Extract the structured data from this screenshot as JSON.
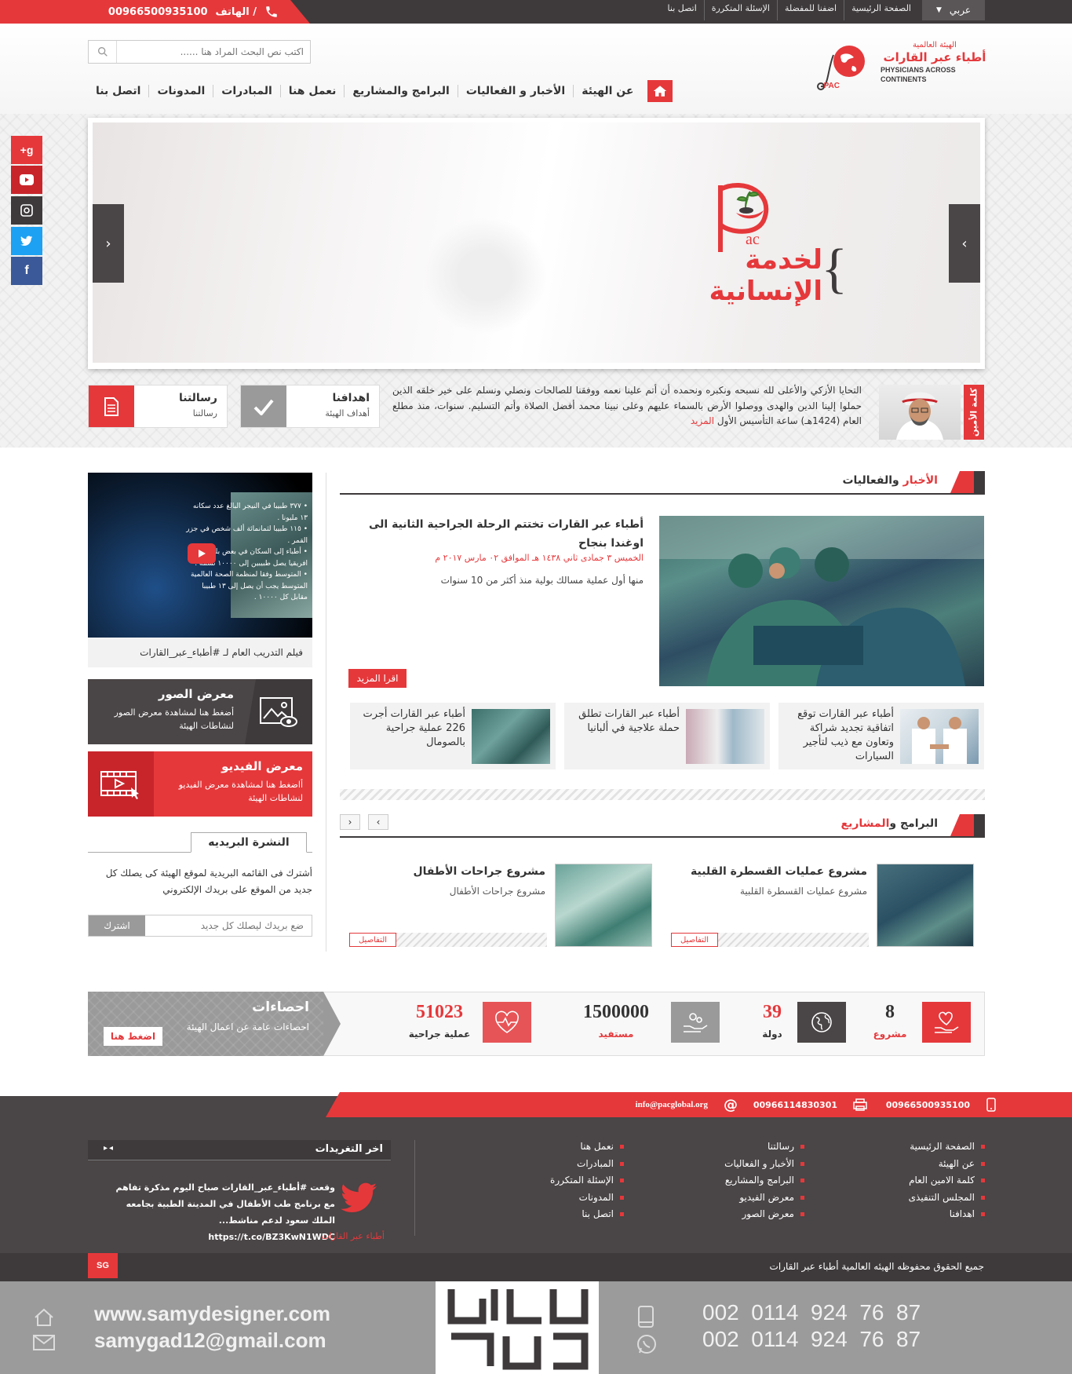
{
  "topbar": {
    "phone_label": "الهاتف /",
    "phone_number": "00966500935100",
    "links": [
      "الصفحة الرئيسية",
      "اضفنا للمفضلة",
      "الإسئلة المتكررة",
      "اتصل بنا"
    ],
    "language": "عربي"
  },
  "logo": {
    "org_small": "الهيئة العالمية",
    "org_name_ar": "أطباء عبر القارات",
    "org_name_en_1": "PHYSICIANS ACROSS",
    "org_name_en_2": "CONTINENTS",
    "abbr": "PAC"
  },
  "search": {
    "placeholder": "اكتب نص البحث المراد هنا ......"
  },
  "nav": {
    "items": [
      "عن الهيئة",
      "الأخبار و الفعاليات",
      "البرامج والمشاريع",
      "نعمل هنا",
      "المبادرات",
      "المدونات",
      "اتصل بنا"
    ]
  },
  "slider": {
    "logo_abbr": "ac",
    "line1": "لخدمة",
    "line2": "الإنسانية"
  },
  "message": {
    "side_label": "كلمة الأمين",
    "text": "التحايا الأزكي والأعلى لله نسبحه ونكبره ونحمده أن أتم علينا نعمه ووفقنا للصالحات ونصلي ونسلم على خير خلقه الذين حملوا إلينا الدين والهدى ووصلوا الأرض بالسماء عليهم وعلى نبينا محمد أفضل الصلاة وأتم التسليم. سنوات، منذ مطلع العام (1424هـ) ساعة التأسيس الأول",
    "more": "المزيد",
    "goals_title": "اهدافنا",
    "goals_sub": "أهداف الهيئة",
    "mission_title": "رسالتنا",
    "mission_sub": "رسالتنا"
  },
  "news": {
    "heading_accent": "الأخبار",
    "heading_rest": "والفعاليات",
    "main_title": "أطباء عبر القارات تختتم الرحلة الجراحية الثانية الى اوغندا بنجاح",
    "main_date": "الخميس ٣ جمادى ثاني ١٤٣٨ هـ الموافق ٠٢ مارس ٢٠١٧ م",
    "main_excerpt": "منها أول عملية مسالك بولية منذ أكثر من 10 سنوات",
    "read_more": "اقرا المزيد",
    "small": [
      "أطباء عبر القارات توقع اتفاقية تجديد شراكة وتعاون مع ذيب لتأجير السيارات",
      "أطباء عبر القارات تطلق حملة علاجية في ألبانيا",
      "أطباء عبر القارات أجرت 226 عملية جراحية بالصومال"
    ]
  },
  "programs": {
    "heading_accent": "المشاريع",
    "heading_rest": "البرامج و",
    "items": [
      {
        "title": "مشروع عمليات القسطرة القلبية",
        "sub": "مشروع عمليات القسطرة القلبية",
        "btn": "التفاصيل"
      },
      {
        "title": "مشروع جراحات الأطفال",
        "sub": "مشروع جراحات الأطفال",
        "btn": "التفاصيل"
      }
    ]
  },
  "sidebar": {
    "video_caption": "فيلم التدريب العام لـ #أطباء_عبر_القارات",
    "video_lines": [
      "• ٣٧٧ طبيبا في النيجر البالغ عدد سكانه",
      "١٣ مليونا .",
      "• ١١٥ طبيبا لثمانمائة ألف شخص في جزر",
      "القمر .",
      "• أطباء إلى السكان في بعض بلدان",
      "افريقيا يصل طبيبين إلى ١٠٠٠٠ نسمة .",
      "• المتوسط وفقا لمنظمة الصحة العالمية",
      "المتوسط يجب أن يصل إلى ١٣ طبيبا",
      "مقابل كل ١٠٠٠٠ ."
    ],
    "gallery_title": "معرض الصور",
    "gallery_sub": "أضغط هنا لمشاهدة معرض الصور لنشاطات الهيئة",
    "vgallery_title": "معرض الفيديو",
    "vgallery_sub": "أاضغط هنا لمشاهدة معرض الفيديو لنشاطات الهيئة",
    "newsletter_title": "النشرة البريديه",
    "newsletter_text": "أشترك فى القائمه البريدية لموقع الهيئة كى يصلك كل جديد من الموقع على بريدك الإلكتروني",
    "newsletter_placeholder": "ضع بريدك ليصلك كل جديد",
    "newsletter_btn": "اشترك"
  },
  "stats": {
    "title": "احصاءات",
    "sub": "احصاءات عامة عن اعمال الهيئة",
    "btn": "اضغط هنا",
    "items": [
      {
        "value": "8",
        "label": "مشروع"
      },
      {
        "value": "39",
        "label": "دولة"
      },
      {
        "value": "1500000",
        "label": "مستفيد"
      },
      {
        "value": "51023",
        "label": "عملية جراحية"
      }
    ]
  },
  "footer": {
    "mobile": "00966500935100",
    "fax": "00966114830301",
    "email": "info@pacglobal.org",
    "col1": [
      "الصفحة الرئيسية",
      "عن الهيئة",
      "كلمة الامين العام",
      "المجلس التنفيذى",
      "اهدافنا"
    ],
    "col2": [
      "رسالتنا",
      "الأخبار و الفعاليات",
      "البرامج والمشاريع",
      "معرض الفيديو",
      "معرض الصور"
    ],
    "col3": [
      "نعمل هنا",
      "المبادرات",
      "الإسئلة المتكررة",
      "المدونات",
      "اتصل بنا"
    ],
    "tweets_title": "اخر التغريدات",
    "tweet_text": "وقعت #أطباء_عبر_القارات صباح اليوم مذكرة تفاهم مع برنامج طب الأطفال في المدينة الطبية بجامعه الملك سعود لدعم مناشط...",
    "tweet_link": "https://t.co/BZ3KwN1WDC",
    "tweet_author": "أطباء عبر القارات",
    "copyright": "جميع الحقوق محفوظه الهيئه العالمية أطباء عبر القارات",
    "designer_badge": "SG"
  },
  "signature": {
    "website": "www.samydesigner.com",
    "email": "samygad12@gmail.com",
    "phone1": "002  0114  924  76  87",
    "phone2": "002  0114  924  76  87"
  },
  "colors": {
    "accent": "#e5383b",
    "dark": "#3e3a3b",
    "mid": "#4a4546"
  }
}
